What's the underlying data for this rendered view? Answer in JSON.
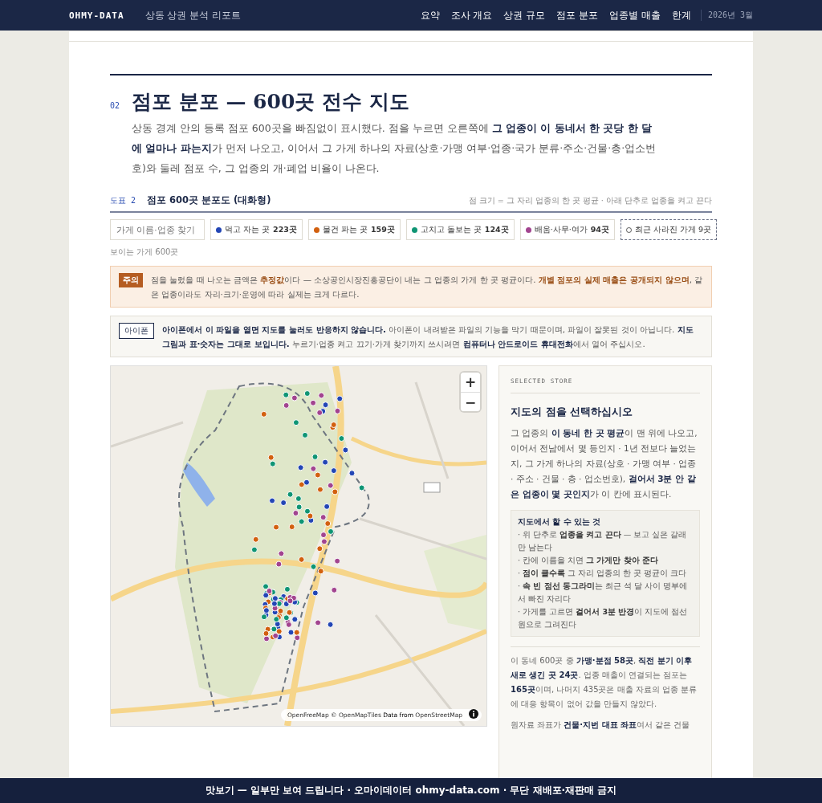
{
  "header": {
    "logo": "OHMY-DATA",
    "subtitle": "상동 상권 분석 리포트",
    "nav": [
      "요약",
      "조사 개요",
      "상권 규모",
      "점포 분포",
      "업종별 매출",
      "한계"
    ],
    "date": "2026년 3월"
  },
  "section": {
    "number": "02",
    "title": "점포 분포 — 600곳 전수 지도",
    "intro": "상동 경계 안의 등록 점포 600곳을 빠짐없이 표시했다. 점을 누르면 오른쪽에 **그 업종이 이 동네서 한 곳당 한 달에 얼마나 파는지**가 먼저 나오고, 이어서 그 가게 하나의 자료(상호·가맹 여부·업종·국가 분류·주소·건물·층·업소번호)와 둘레 점포 수, 그 업종의 개·폐업 비율이 나온다."
  },
  "figure": {
    "label": "도표 2",
    "title": "점포 600곳 분포도 (대화형)",
    "note": "점 크기 = 그 자리 업종의 한 곳 평균 · 아래 단추로 업종을 켜고 끈다"
  },
  "search": {
    "placeholder": "가게 이름·업종 찾기"
  },
  "filters": [
    {
      "kind": "category",
      "color": "#2346b5",
      "label": "먹고 자는 곳 **223곳**"
    },
    {
      "kind": "category",
      "color": "#d2600f",
      "label": "물건 파는 곳 **159곳**"
    },
    {
      "kind": "category",
      "color": "#0f9574",
      "label": "고치고 돌보는 곳 **124곳**"
    },
    {
      "kind": "category",
      "color": "#a2448f",
      "label": "배움·사무·여가 **94곳**"
    },
    {
      "kind": "closed",
      "label": "최근 사라진 가게 9곳"
    }
  ],
  "visible_count": "보이는 가게 600곳",
  "notices": [
    {
      "kind": "caution",
      "badge": "주의",
      "text": "점을 눌렀을 때 나오는 금액은 **추정값**이다 — 소상공인시장진흥공단이 내는 그 업종의 가게 한 곳 평균이다. **개별 점포의 실제 매출은 공개되지 않으며**, 같은 업종이라도 자리·크기·운영에 따라 실제는 크게 다르다."
    },
    {
      "kind": "info",
      "badge": "아이폰",
      "text": "**아이폰에서 이 파일을 열면 지도를 눌러도 반응하지 않습니다.** 아이폰이 내려받은 파일의 기능을 막기 때문이며, 파일이 잘못된 것이 아닙니다. **지도 그림과 표·숫자는 그대로 보입니다.** 누르기·업종 켜고 끄기·가게 찾기까지 쓰시려면 **컴퓨터나 안드로이드 휴대전화**에서 열어 주십시오."
    }
  ],
  "map": {
    "kind": "picture",
    "zoom_in": "+",
    "zoom_out": "−",
    "attribution": "OpenFreeMap © OpenMapTiles **Data from** OpenStreetMap"
  },
  "panel": {
    "eyebrow": "SELECTED STORE",
    "title": "지도의 점을 선택하십시오",
    "text": "그 업종의 **이 동네 한 곳 평균**이 맨 위에 나오고, 이어서 전남에서 몇 등인지 · 1년 전보다 늘었는지, 그 가게 하나의 자료(상호 · 가맹 여부 · 업종 · 주소 · 건물 · 층 · 업소번호), **걸어서 3분 안 같은 업종이 몇 곳인지**가 이 칸에 표시된다.",
    "tips_title": "지도에서 할 수 있는 것",
    "tips": [
      "· 위 단추로 **업종을 켜고 끈다** — 보고 싶은 갈래만 남는다",
      "· 칸에 이름을 치면 **그 가게만 찾아 준다**",
      "· **점이 클수록** 그 자리 업종의 한 곳 평균이 크다",
      "· **속 빈 점선 동그라미**는 최근 석 달 사이 명부에서 빠진 자리다",
      "· 가게를 고르면 **걸어서 3분 반경**이 지도에 점선 원으로 그려진다"
    ],
    "notes": [
      "이 동네 600곳 중 **가맹·분점 58곳**, **직전 분기 이후 새로 생긴 곳 24곳**. 업종 매출이 연결되는 점포는 **165곳**이며, 나머지 435곳은 매출 자료의 업종 분류에 대응 항목이 없어 값을 만들지 않았다.",
      "원자료 좌표가 **건물·지번 대표 좌표**여서 같은 건물"
    ]
  },
  "footer": "맛보기 — 일부만 보여 드립니다 · 오마이데이터 ohmy-data.com · 무단 재배포·재판매 금지"
}
